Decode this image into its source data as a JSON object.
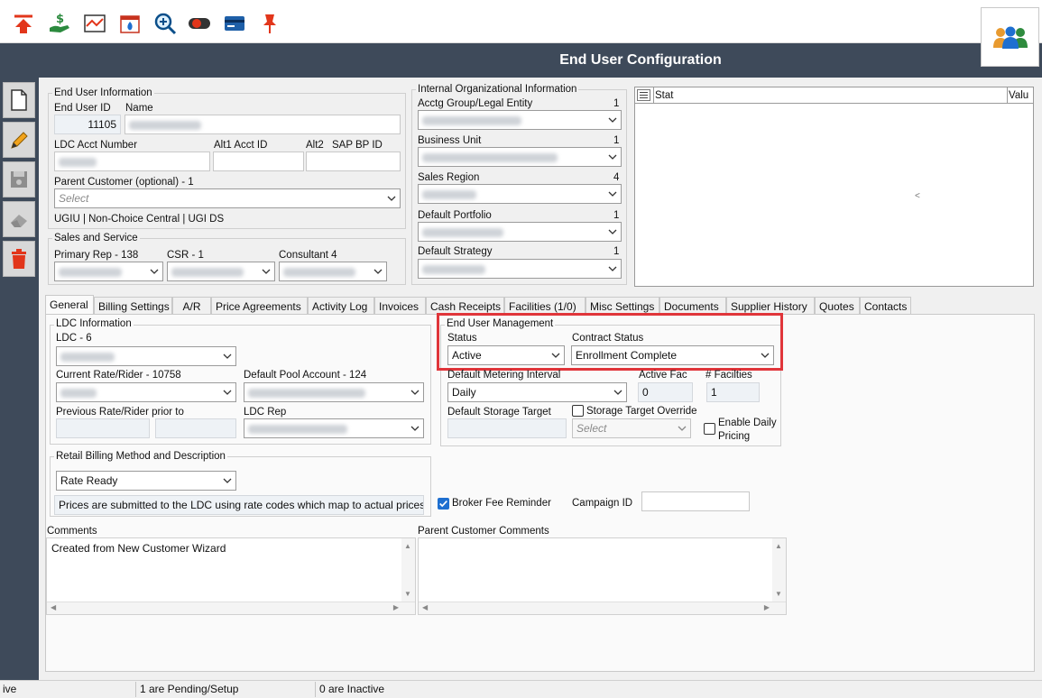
{
  "window": {
    "title": "End User Configuration"
  },
  "end_user_info": {
    "legend": "End User Information",
    "id_label": "End User ID",
    "id_value": "11105",
    "name_label": "Name",
    "ldc_acct_label": "LDC Acct Number",
    "alt1_label": "Alt1 Acct ID",
    "alt2_label": "Alt2",
    "sap_label": "SAP BP ID",
    "parent_label": "Parent Customer (optional) -  1",
    "parent_placeholder": "Select",
    "tags": "UGIU  |  Non-Choice Central  |  UGI DS"
  },
  "sales_service": {
    "legend": "Sales and Service",
    "primary_rep_label": "Primary Rep - 138",
    "csr_label": "CSR - 1",
    "consultant_label": "Consultant  4"
  },
  "internal_org": {
    "legend": "Internal Organizational Information",
    "fields": [
      {
        "label": "Acctg Group/Legal Entity",
        "count": "1"
      },
      {
        "label": "Business Unit",
        "count": "1"
      },
      {
        "label": "Sales Region",
        "count": "4"
      },
      {
        "label": "Default Portfolio",
        "count": "1"
      },
      {
        "label": "Default Strategy",
        "count": "1"
      }
    ]
  },
  "stat_grid": {
    "col1": "Stat",
    "col2": "Valu",
    "marker": "<"
  },
  "tabs": [
    {
      "label": "General",
      "active": true
    },
    {
      "label": "Billing Settings"
    },
    {
      "label": "A/R"
    },
    {
      "label": "Price Agreements"
    },
    {
      "label": "Activity Log"
    },
    {
      "label": "Invoices"
    },
    {
      "label": "Cash Receipts"
    },
    {
      "label": "Facilities (1/0)"
    },
    {
      "label": "Misc Settings"
    },
    {
      "label": "Documents"
    },
    {
      "label": "Supplier History"
    },
    {
      "label": "Quotes"
    },
    {
      "label": "Contacts"
    }
  ],
  "ldc_info": {
    "legend": "LDC Information",
    "ldc_label": "LDC - 6",
    "current_rate_label": "Current Rate/Rider - 10758",
    "default_pool_label": "Default Pool Account - 124",
    "prev_rate_label": "Previous Rate/Rider prior to",
    "ldc_rep_label": "LDC Rep"
  },
  "eum": {
    "legend": "End User Management",
    "status_label": "Status",
    "status_value": "Active",
    "contract_label": "Contract Status",
    "contract_value": "Enrollment Complete",
    "metering_label": "Default Metering Interval",
    "metering_value": "Daily",
    "active_fac_label": "Active Fac",
    "active_fac_value": "0",
    "num_fac_label": "# Facilties",
    "num_fac_value": "1",
    "storage_label": "Default Storage Target",
    "storage_override_label": "Storage Target Override",
    "storage_placeholder": "Select",
    "daily_pricing_label_1": "Enable Daily",
    "daily_pricing_label_2": "Pricing"
  },
  "retail_billing": {
    "legend": "Retail Billing Method and Description",
    "method": "Rate Ready",
    "description": "Prices are submitted to the LDC using rate codes which map to actual prices"
  },
  "broker_fee_label": "Broker Fee Reminder",
  "campaign_label": "Campaign ID",
  "comments": {
    "label": "Comments",
    "value": "Created from New Customer Wizard"
  },
  "parent_comments": {
    "label": "Parent Customer Comments"
  },
  "status_bar": {
    "seg1": "ive",
    "seg2": "1 are Pending/Setup",
    "seg3": "0 are Inactive"
  }
}
